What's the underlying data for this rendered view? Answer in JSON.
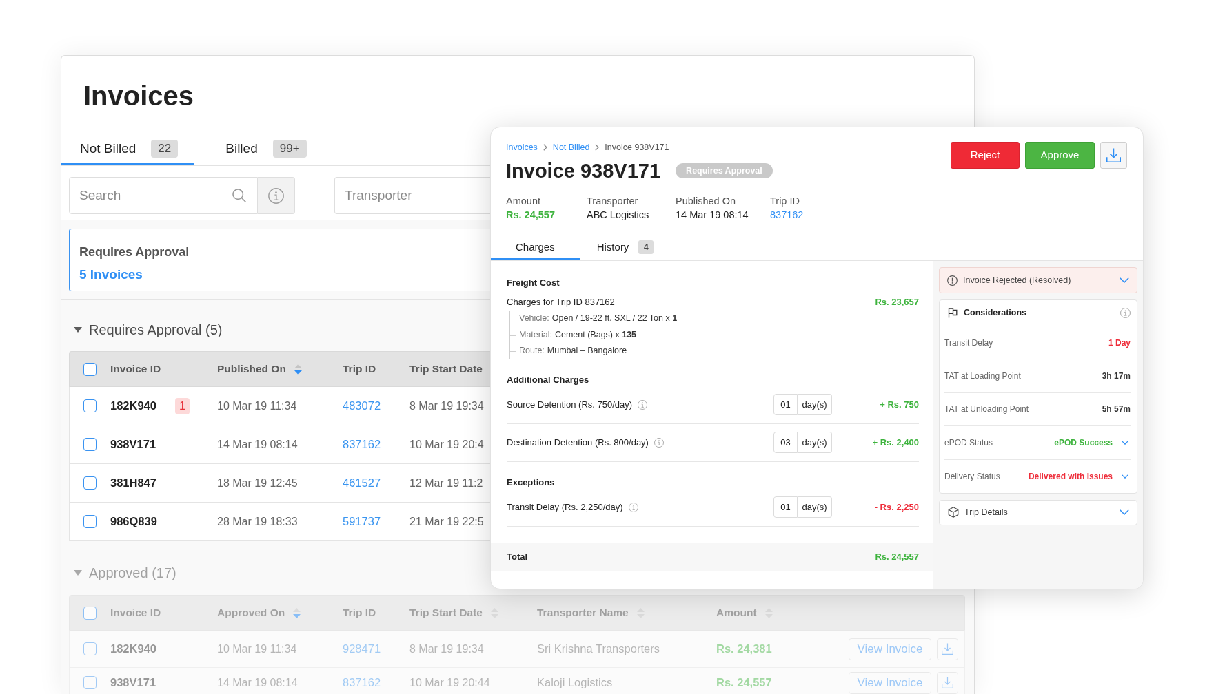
{
  "page": {
    "title": "Invoices"
  },
  "tabs": [
    {
      "label": "Not Billed",
      "count": "22",
      "selected": true
    },
    {
      "label": "Billed",
      "count": "99+",
      "selected": false
    }
  ],
  "filters": {
    "search": {
      "placeholder": "Search"
    },
    "transporter": {
      "placeholder": "Transporter"
    }
  },
  "summary": {
    "title": "Requires Approval",
    "link": "5 Invoices"
  },
  "sections": [
    {
      "title": "Requires Approval (5)",
      "expanded": true,
      "all_checked": false,
      "columns": [
        {
          "label": "Invoice ID",
          "kind": "id",
          "sortable": false
        },
        {
          "label": "Published On",
          "kind": "date",
          "sortable": true,
          "sorted": true
        },
        {
          "label": "Trip ID",
          "kind": "link",
          "sortable": false
        },
        {
          "label": "Trip Start Date",
          "kind": "date",
          "sortable": false
        }
      ],
      "rows": [
        {
          "checked": false,
          "badge": "1",
          "cells": [
            "182K940",
            "10 Mar 19 11:34",
            "483072",
            "8 Mar 19 19:34"
          ]
        },
        {
          "checked": false,
          "cells": [
            "938V171",
            "14 Mar 19 08:14",
            "837162",
            "10 Mar 19 20:4"
          ]
        },
        {
          "checked": false,
          "cells": [
            "381H847",
            "18 Mar 19 12:45",
            "461527",
            "12 Mar 19 11:2"
          ]
        },
        {
          "checked": false,
          "cells": [
            "986Q839",
            "28 Mar 19 18:33",
            "591737",
            "21 Mar 19 22:5"
          ]
        }
      ]
    },
    {
      "title": "Approved (17)",
      "expanded": true,
      "all_checked": false,
      "columns": [
        {
          "label": "Invoice ID",
          "kind": "id",
          "sortable": false
        },
        {
          "label": "Approved On",
          "kind": "date",
          "sortable": true,
          "sorted": true
        },
        {
          "label": "Trip ID",
          "kind": "link",
          "sortable": false
        },
        {
          "label": "Trip Start Date",
          "kind": "date",
          "sortable": true,
          "sorted": false
        },
        {
          "label": "Transporter Name",
          "kind": "name",
          "sortable": true,
          "sorted": false
        },
        {
          "label": "Amount",
          "kind": "amount",
          "sortable": true,
          "sorted": false
        }
      ],
      "rows": [
        {
          "checked": false,
          "cells": [
            "182K940",
            "10 Mar 19 11:34",
            "928471",
            "8 Mar 19 19:34",
            "Sri Krishna Transporters",
            "Rs. 24,381"
          ],
          "action": "View Invoice"
        },
        {
          "checked": false,
          "cells": [
            "938V171",
            "14 Mar 19 08:14",
            "837162",
            "10 Mar 19 20:44",
            "Kaloji Logistics",
            "Rs. 24,557"
          ],
          "action": "View Invoice"
        }
      ]
    }
  ],
  "detail": {
    "breadcrumb": [
      {
        "label": "Invoices",
        "link": true
      },
      {
        "label": "Not Billed",
        "link": true
      },
      {
        "label": "Invoice 938V171",
        "link": false
      }
    ],
    "title": "Invoice 938V171",
    "status": "Requires Approval",
    "actions": [
      {
        "kind": "reject",
        "label": "Reject"
      },
      {
        "kind": "approve",
        "label": "Approve"
      },
      {
        "kind": "download"
      }
    ],
    "meta": [
      {
        "label": "Amount",
        "value": "Rs. 24,557",
        "kind": "amount"
      },
      {
        "label": "Transporter",
        "value": "ABC Logistics",
        "kind": "text"
      },
      {
        "label": "Published On",
        "value": "14 Mar 19 08:14",
        "kind": "text"
      },
      {
        "label": "Trip ID",
        "value": "837162",
        "kind": "link"
      }
    ],
    "tabs": [
      {
        "label": "Charges",
        "selected": true
      },
      {
        "label": "History",
        "count": "4",
        "selected": false
      }
    ],
    "charge_groups": [
      {
        "title": "Freight Cost",
        "items": [
          {
            "kind": "line",
            "label": "Charges for Trip ID 837162",
            "amount": "Rs. 23,657",
            "color": "#3db33d",
            "details": [
              {
                "label": "Vehicle:",
                "value": "Open / 19-22 ft. SXL / 22 Ton x **1**"
              },
              {
                "label": "Material:",
                "value": "Cement (Bags) x **135**"
              },
              {
                "label": "Route:",
                "value": "Mumbai – Bangalore"
              }
            ]
          }
        ]
      },
      {
        "title": "Additional Charges",
        "items": [
          {
            "kind": "days",
            "label": "Source Detention (Rs. 750/day)",
            "days": "01",
            "unit": "day(s)",
            "amount": "+ Rs. 750",
            "color": "#3db33d"
          },
          {
            "kind": "days",
            "label": "Destination Detention (Rs. 800/day)",
            "days": "03",
            "unit": "day(s)",
            "amount": "+ Rs. 2,400",
            "color": "#3db33d"
          }
        ]
      },
      {
        "title": "Exceptions",
        "items": [
          {
            "kind": "days",
            "label": "Transit Delay (Rs. 2,250/day)",
            "days": "01",
            "unit": "day(s)",
            "amount": "- Rs. 2,250",
            "color": "#ee2d3a"
          }
        ]
      }
    ],
    "total": {
      "label": "Total",
      "amount": "Rs. 24,557",
      "color": "#3db33d"
    },
    "alert": {
      "title": "Invoice Rejected (Resolved)",
      "expanded": false
    },
    "considerations": {
      "title": "Considerations",
      "rows": [
        {
          "label": "Transit Delay",
          "value": "1 Day",
          "color": "#ee2d3a",
          "dropdown": false
        },
        {
          "label": "TAT at Loading Point",
          "value": "3h 17m",
          "color": "#333333",
          "dropdown": false
        },
        {
          "label": "TAT at Unloading Point",
          "value": "5h 57m",
          "color": "#333333",
          "dropdown": false
        },
        {
          "label": "ePOD Status",
          "value": "ePOD Success",
          "color": "#3db33d",
          "dropdown": true
        },
        {
          "label": "Delivery Status",
          "value": "Delivered with Issues",
          "color": "#ee2d3a",
          "dropdown": true
        }
      ]
    },
    "trip_details": {
      "title": "Trip Details",
      "expanded": false
    }
  }
}
